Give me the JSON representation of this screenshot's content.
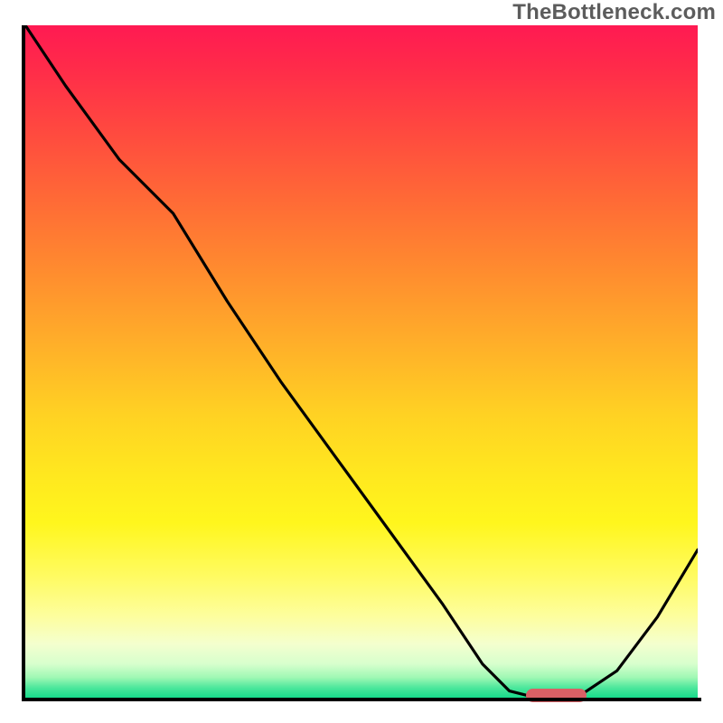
{
  "watermark_text": "TheBottleneck.com",
  "colors": {
    "gradient_top": "#ff1a52",
    "gradient_mid": "#ffd223",
    "gradient_bottom": "#17db8b",
    "curve": "#000000",
    "axis": "#000000",
    "marker": "#d96065"
  },
  "chart_data": {
    "type": "line",
    "title": "",
    "xlabel": "",
    "ylabel": "",
    "xlim": [
      0,
      100
    ],
    "ylim": [
      0,
      100
    ],
    "x": [
      0,
      6,
      14,
      22,
      30,
      38,
      46,
      54,
      62,
      68,
      72,
      76,
      82,
      88,
      94,
      100
    ],
    "values": [
      100,
      91,
      80,
      72,
      59,
      47,
      36,
      25,
      14,
      5,
      1,
      0,
      0,
      4,
      12,
      22
    ],
    "marker": {
      "x_center": 79,
      "y_center": 0.3,
      "width": 9,
      "height": 2
    }
  }
}
